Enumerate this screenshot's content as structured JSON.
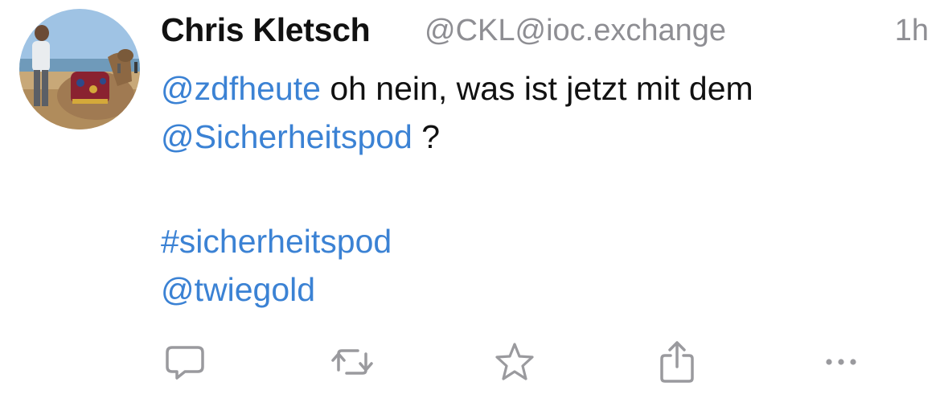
{
  "author": {
    "display_name": "Chris Kletsch",
    "handle": "@CKL@ioc.exchange",
    "avatar_icon": "avatar-photo-camel-beach"
  },
  "post": {
    "time": "1h",
    "line1_mention": "@zdfheute",
    "line1_text": " oh nein, was ist jetzt mit dem",
    "line2_mention": "@Sicherheitspod",
    "line2_text": " ?",
    "hashtag": "#sicherheitspod",
    "mention3": "@twiegold"
  },
  "actions": [
    {
      "icon": "reply-icon"
    },
    {
      "icon": "boost-icon"
    },
    {
      "icon": "favorite-icon"
    },
    {
      "icon": "share-icon"
    },
    {
      "icon": "more-icon"
    }
  ],
  "colors": {
    "link": "#3b82d4",
    "muted": "#8e8e93",
    "text": "#111111",
    "icon": "#9a9a9e"
  }
}
